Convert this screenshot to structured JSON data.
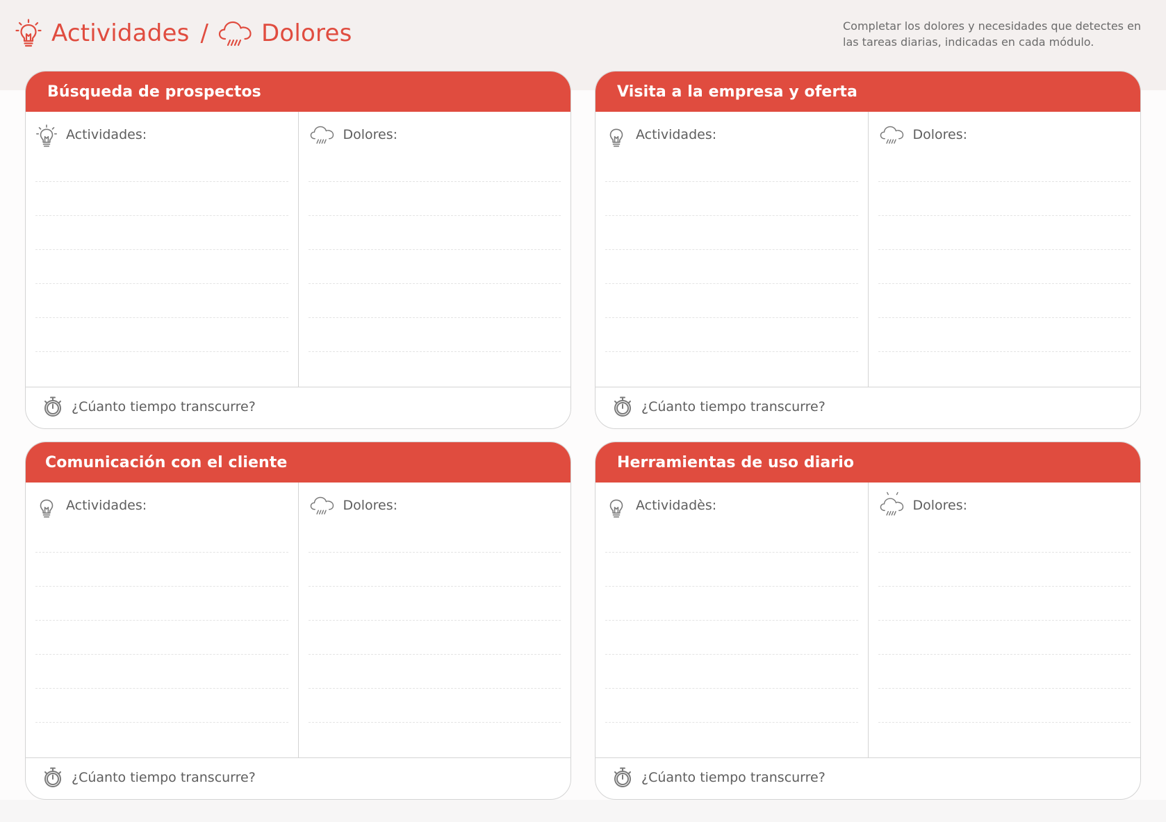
{
  "header": {
    "activities_title": "Actividades",
    "separator": "/",
    "pains_title": "Dolores",
    "activities_icon": "lightbulb-icon",
    "pains_icon": "rain-cloud-icon"
  },
  "instructions": "Completar los dolores y necesidades que detectes en las tareas diarias, indicadas en cada módulo.",
  "colors": {
    "accent": "#e04c3f",
    "text": "#5e5e5e",
    "border": "#d4d4d4"
  },
  "cards": [
    {
      "title": "Búsqueda de prospectos",
      "activities_label": "Actividades:",
      "pains_label": "Dolores:",
      "time_question": "¿Cúanto tiempo transcurre?"
    },
    {
      "title": "Visita a la empresa y oferta",
      "activities_label": "Actividades:",
      "pains_label": "Dolores:",
      "time_question": "¿Cúanto tiempo transcurre?"
    },
    {
      "title": "Comunicación con el cliente",
      "activities_label": "Actividades:",
      "pains_label": "Dolores:",
      "time_question": "¿Cúanto tiempo transcurre?"
    },
    {
      "title": "Herramientas de uso diario",
      "activities_label": "Actividadès:",
      "pains_label": "Dolores:",
      "time_question": "¿Cúanto tiempo transcurre?"
    }
  ]
}
